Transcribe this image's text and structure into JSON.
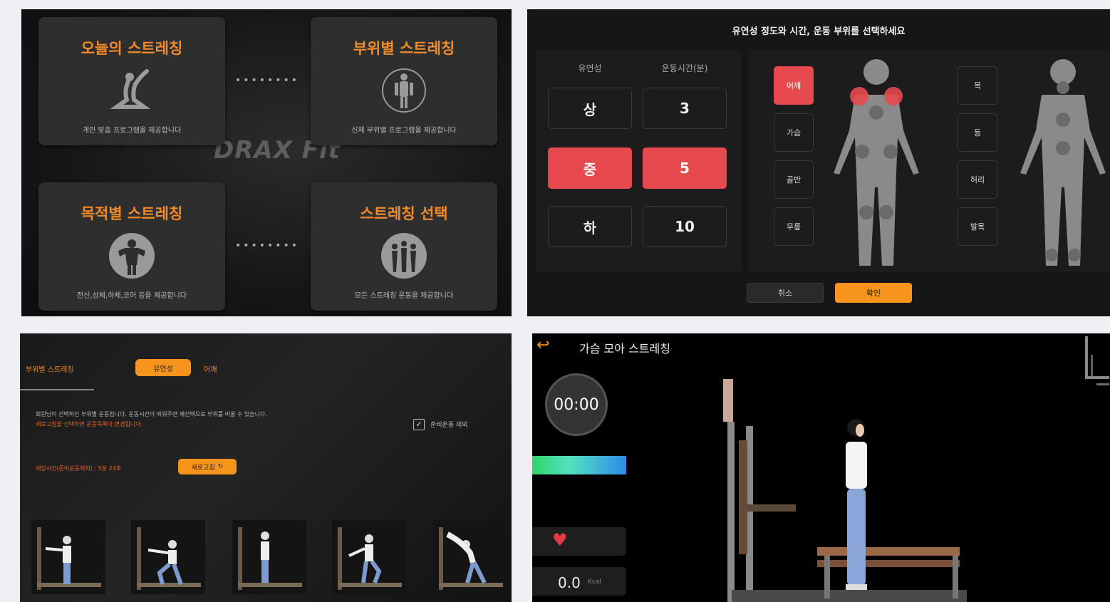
{
  "panel_menu": {
    "cards": [
      {
        "title": "오늘의 스트레칭",
        "desc": "개인 맞춤 프로그램을 제공합니다",
        "icon": "yoga-pose-icon"
      },
      {
        "title": "부위별 스트레칭",
        "desc": "신체 부위별 프로그램을 제공합니다",
        "icon": "body-parts-icon"
      },
      {
        "title": "목적별 스트레칭",
        "desc": "전신,상체,하체,코어 등을 제공합니다",
        "icon": "muscle-icon"
      },
      {
        "title": "스트레칭 선택",
        "desc": "모든 스트레칭 운동을 제공합니다",
        "icon": "people-group-icon"
      }
    ],
    "dots": "••••••••",
    "brand": "DRAX Fit"
  },
  "panel_select": {
    "title": "유연성 정도와 시간, 운동 부위를 선택하세요",
    "col_flex": "유연성",
    "col_time": "운동시간(분)",
    "flex_options": [
      "상",
      "중",
      "하"
    ],
    "time_options": [
      "3",
      "5",
      "10"
    ],
    "parts_front": [
      "어깨",
      "가슴",
      "골반",
      "무릎"
    ],
    "parts_back": [
      "목",
      "등",
      "허리",
      "발목"
    ],
    "cancel": "취소",
    "confirm": "확인",
    "colors": {
      "accent": "#e64a4f",
      "orange": "#f7941d"
    }
  },
  "panel_program": {
    "header": "부위별 스트레칭",
    "tab_active": "유연성",
    "tab_other": "어깨",
    "info": "회원님이 선택하신 부위별 운동입니다. 운동시간이 외워주면 재선택으로 부위를 바꿀 수 있습니다.",
    "info2": "새로고침을 선택하면 운동목록이 변경됩니다.",
    "checkbox_label": "준비운동 제외",
    "time_label": "예상시간(준비운동제외) : 5분 24초",
    "refresh": "새로고침"
  },
  "panel_workout": {
    "title": "가슴 모아 스트레칭",
    "timer": "00:00",
    "kcal_value": "0.0",
    "kcal_unit": "Kcal"
  }
}
